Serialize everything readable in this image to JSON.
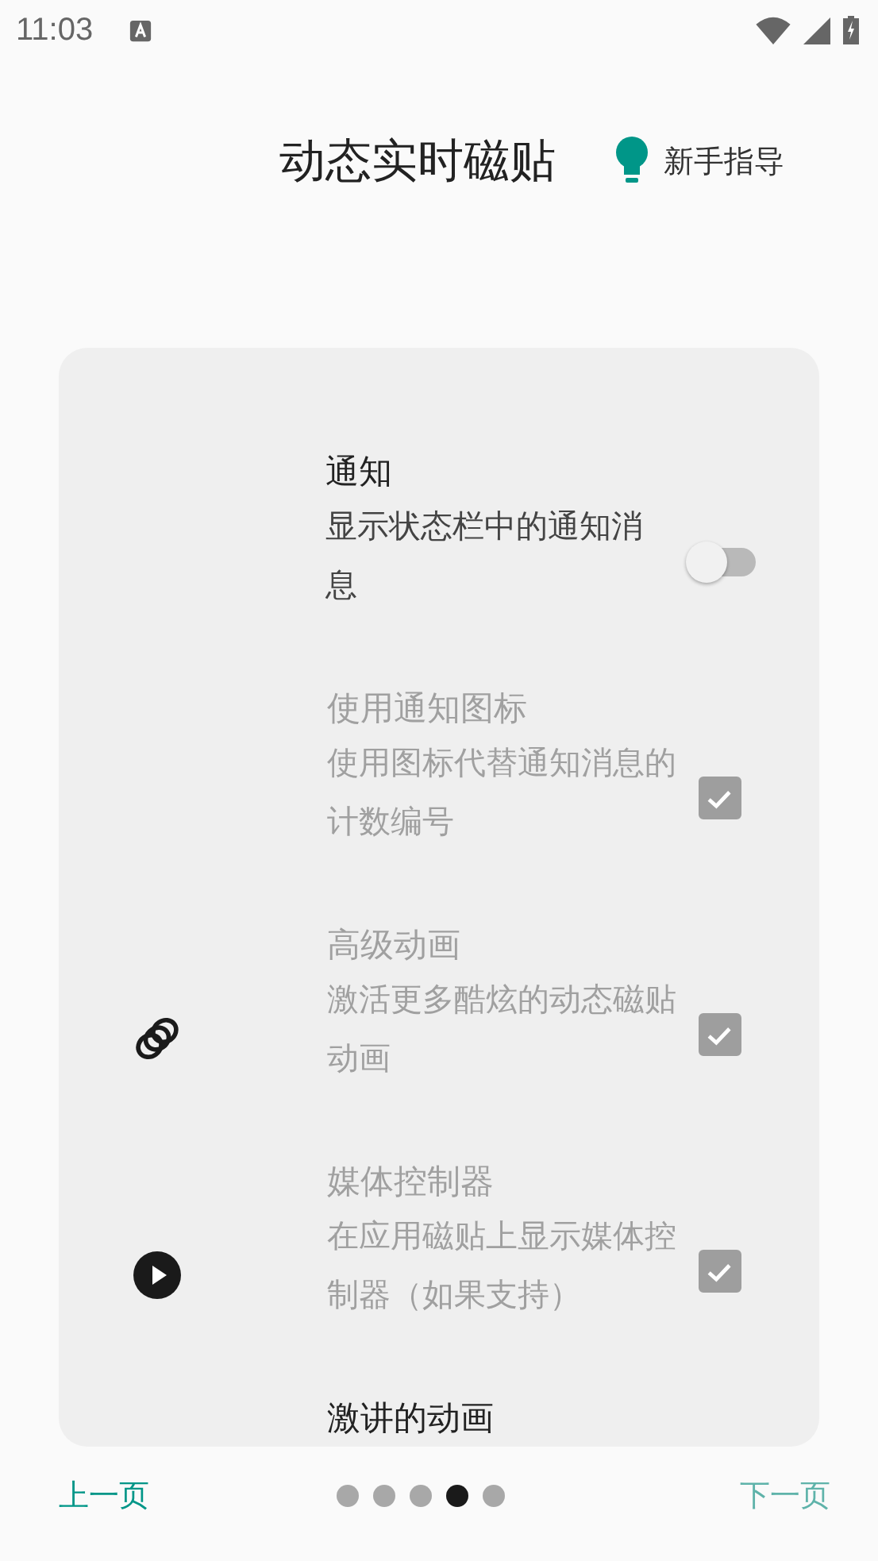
{
  "status_bar": {
    "time": "11:03"
  },
  "header": {
    "title": "动态实时磁贴",
    "guide": "新手指导"
  },
  "settings": [
    {
      "kind": "toggle",
      "title": "通知",
      "subtitle": "显示状态栏中的通知消息",
      "disabled": false,
      "on": false
    },
    {
      "kind": "checkbox",
      "title": "使用通知图标",
      "subtitle": "使用图标代替通知消息的计数编号",
      "disabled": true,
      "checked": true
    },
    {
      "kind": "checkbox",
      "title": "高级动画",
      "subtitle": "激活更多酷炫的动态磁贴动画",
      "disabled": true,
      "checked": true
    },
    {
      "kind": "checkbox",
      "title": "媒体控制器",
      "subtitle": "在应用磁贴上显示媒体控制器（如果支持）",
      "disabled": true,
      "checked": true
    },
    {
      "kind": "heading",
      "title": "激讲的动画",
      "disabled": false
    }
  ],
  "footer": {
    "prev": "上一页",
    "next": "下一页",
    "pages": [
      {
        "selected": false
      },
      {
        "selected": false
      },
      {
        "selected": false
      },
      {
        "selected": true
      },
      {
        "selected": false
      }
    ]
  }
}
